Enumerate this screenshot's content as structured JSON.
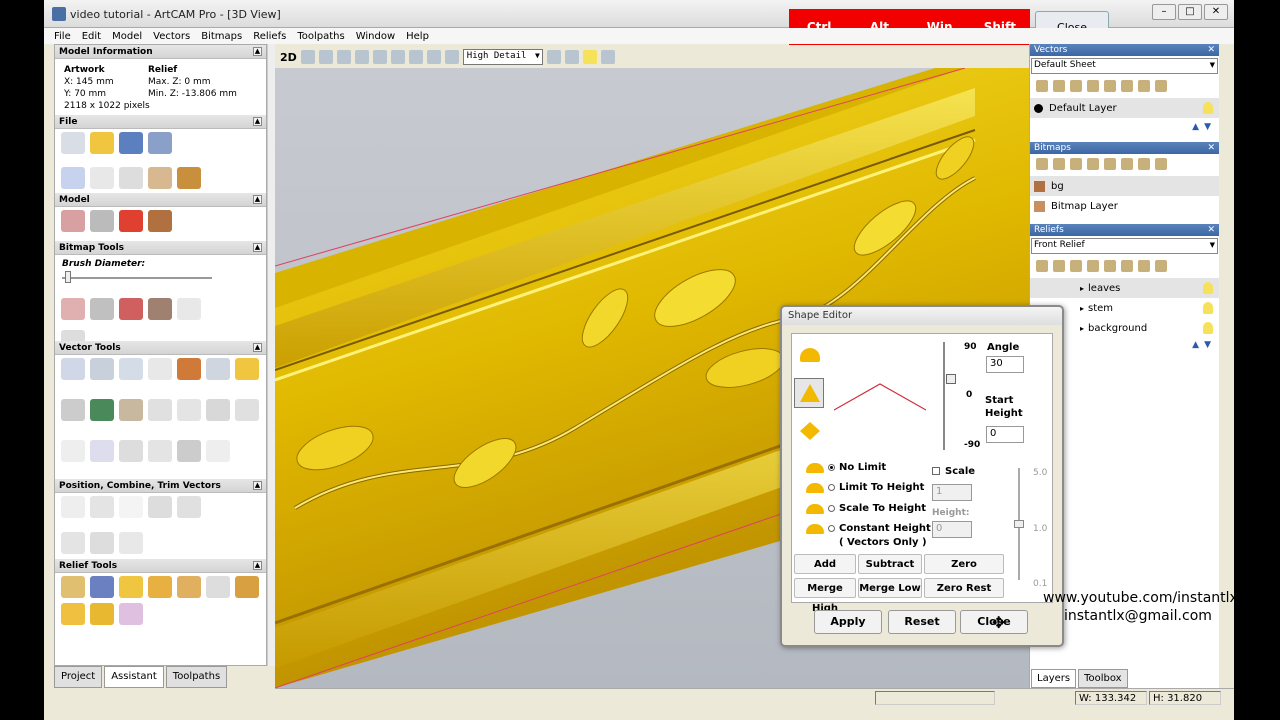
{
  "window": {
    "title": "video tutorial - ArtCAM Pro - [3D View]"
  },
  "keys": [
    "Ctrl",
    "Alt",
    "Win",
    "Shift"
  ],
  "key_close": "Close",
  "menu": [
    "File",
    "Edit",
    "Model",
    "Vectors",
    "Bitmaps",
    "Reliefs",
    "Toolpaths",
    "Window",
    "Help"
  ],
  "left": {
    "model_information": "Model Information",
    "artwork": {
      "heading": "Artwork",
      "x": "X: 145 mm",
      "y": "Y: 70 mm",
      "pixels": "2118 x 1022 pixels"
    },
    "relief": {
      "heading": "Relief",
      "maxz": "Max. Z: 0 mm",
      "minz": "Min. Z: -13.806 mm"
    },
    "file": "File",
    "model": "Model",
    "bitmap_tools": "Bitmap Tools",
    "brush_diameter": "Brush Diameter:",
    "vector_tools": "Vector Tools",
    "position_combine": "Position, Combine, Trim Vectors",
    "relief_tools": "Relief Tools"
  },
  "bottom_tabs": [
    "Project",
    "Assistant",
    "Toolpaths"
  ],
  "view_toolbar": {
    "mode": "2D",
    "detail": "High Detail"
  },
  "right": {
    "vectors": {
      "title": "Vectors",
      "sheet": "Default Sheet",
      "layer": "Default Layer"
    },
    "bitmaps": {
      "title": "Bitmaps",
      "layers": [
        "bg",
        "Bitmap Layer"
      ]
    },
    "reliefs": {
      "title": "Reliefs",
      "relief": "Front Relief",
      "layers": [
        "leaves",
        "stem",
        "background"
      ]
    },
    "tabs": [
      "Layers",
      "Toolbox"
    ]
  },
  "status": {
    "w": "W: 133.342",
    "h": "H: 31.820"
  },
  "shape_editor": {
    "title": "Shape Editor",
    "slider": {
      "top": "90",
      "mid": "0",
      "bottom": "-90"
    },
    "angle_label": "Angle",
    "angle": "30",
    "start_height_label": "Start Height",
    "start_height": "0",
    "options": [
      "No Limit",
      "Limit To Height",
      "Scale To Height",
      "Constant Height",
      "( Vectors Only )"
    ],
    "scale_label": "Scale",
    "scale_value": "1",
    "height_label": "Height:",
    "height_value": "0",
    "scale_slider": {
      "top": "5.0",
      "mid": "1.0",
      "bottom": "0.1"
    },
    "buttons": [
      "Add",
      "Subtract",
      "Zero",
      "Merge High",
      "Merge Low",
      "Zero Rest"
    ],
    "actions": [
      "Apply",
      "Reset",
      "Close"
    ]
  },
  "overlay": {
    "youtube": "www.youtube.com/instantlx",
    "email": "instantlx@gmail.com"
  },
  "colors": {
    "relief": "#e8c400",
    "panel_head": "#3c67a4",
    "keys": "#f20000"
  }
}
